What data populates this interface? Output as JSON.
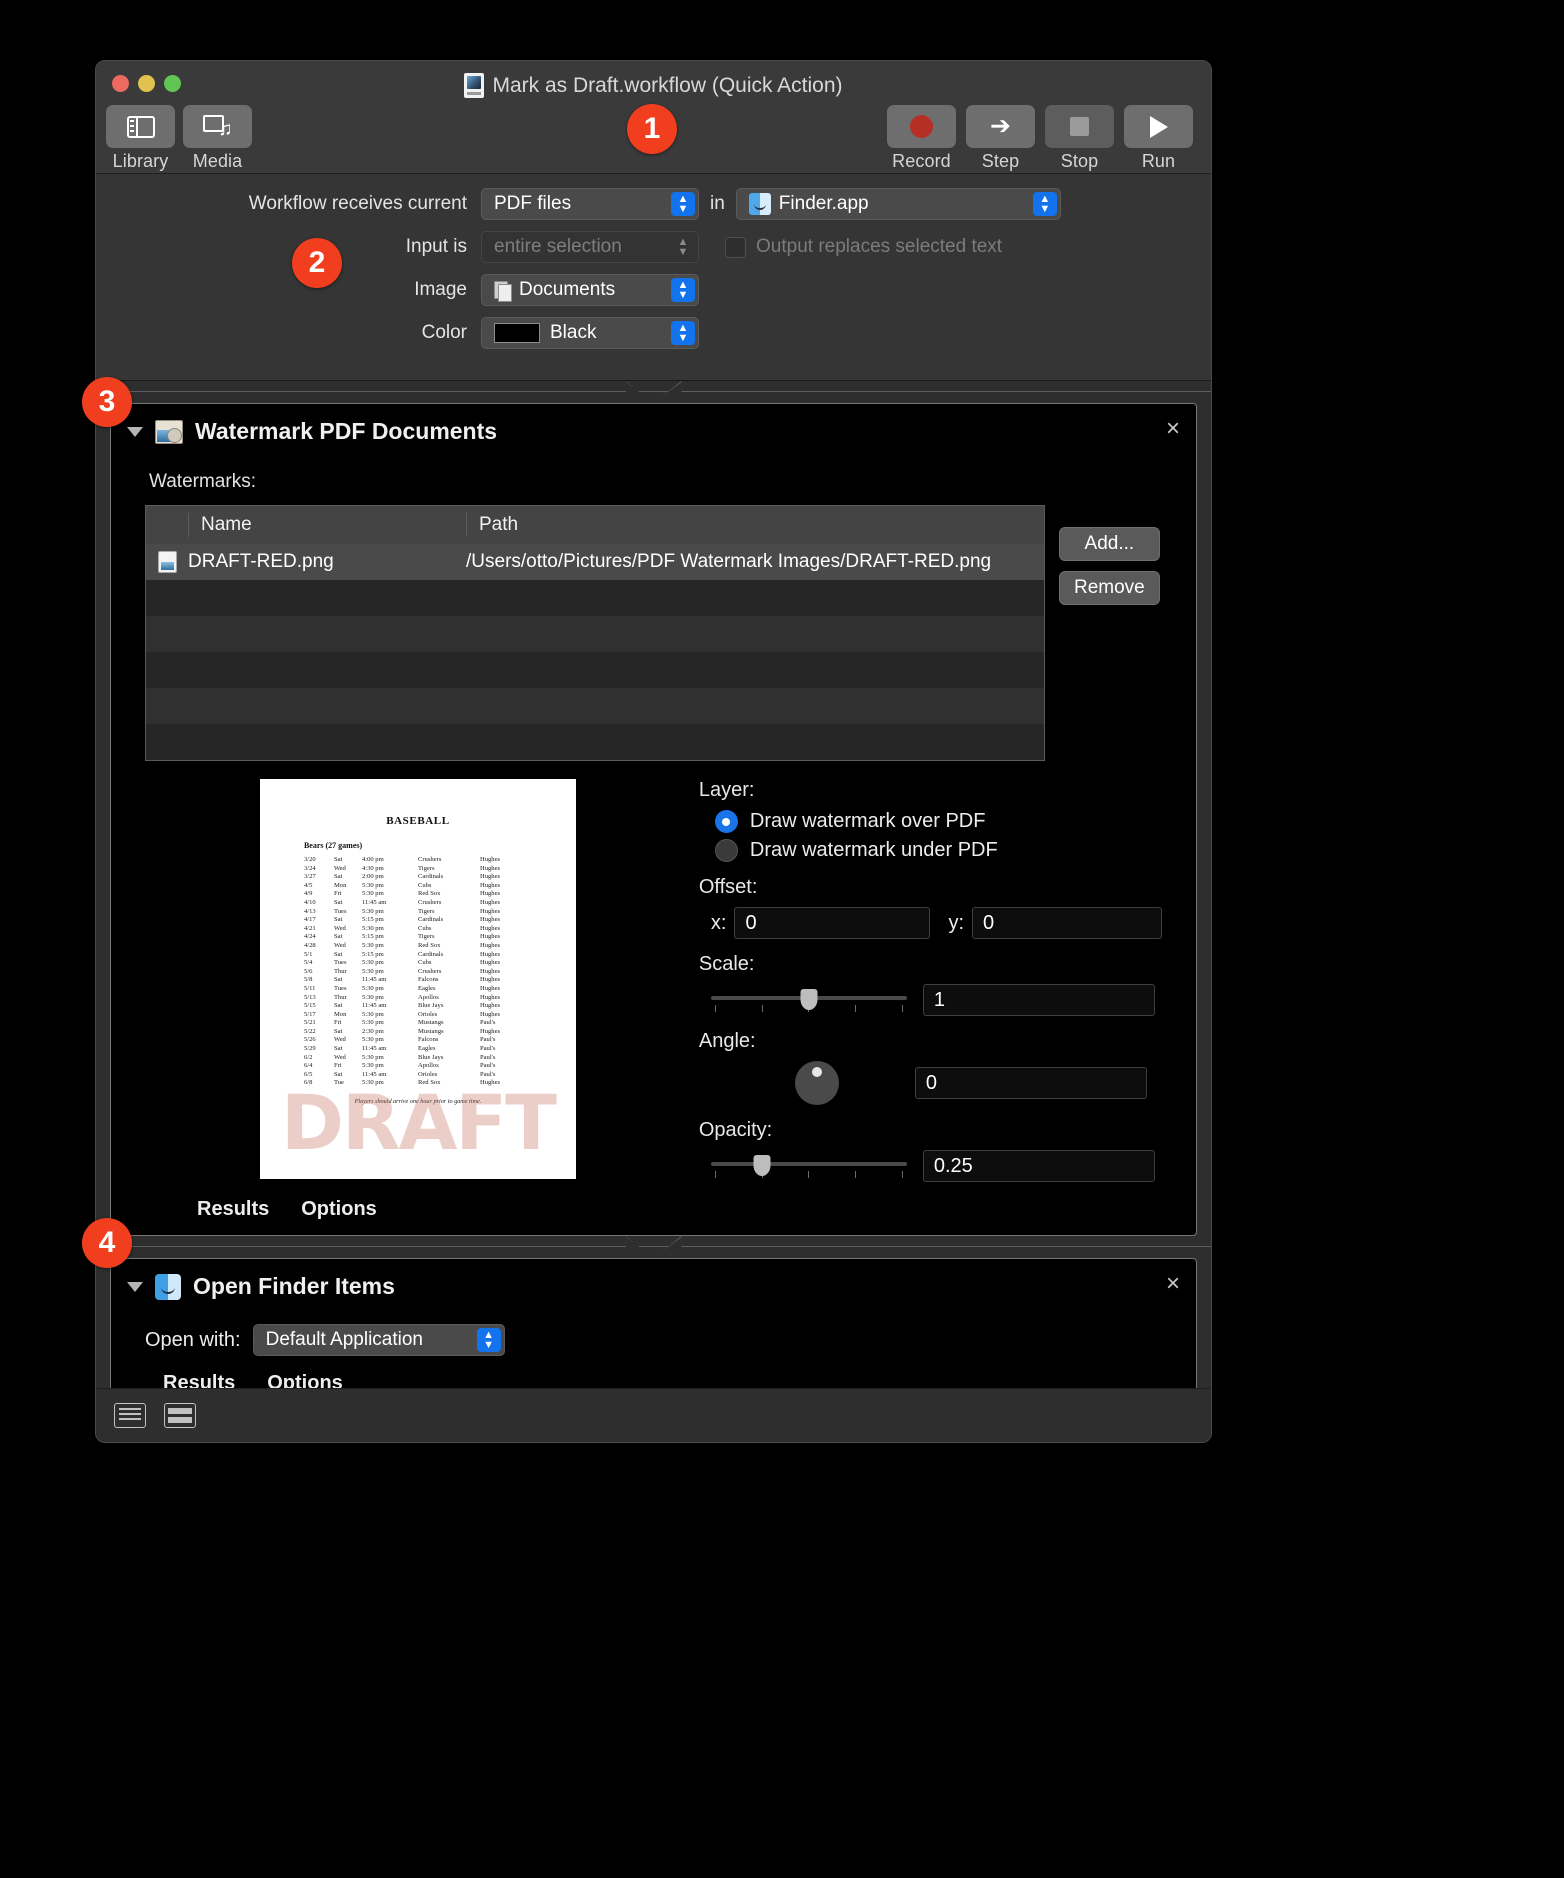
{
  "window": {
    "title": "Mark as Draft.workflow (Quick Action)",
    "doc_icon": "workflow-document-icon"
  },
  "toolbar": {
    "left": [
      {
        "label": "Library",
        "icon": "library-icon"
      },
      {
        "label": "Media",
        "icon": "media-icon"
      }
    ],
    "right": [
      {
        "label": "Record",
        "icon": "record-icon"
      },
      {
        "label": "Step",
        "icon": "step-forward-icon"
      },
      {
        "label": "Stop",
        "icon": "stop-icon"
      },
      {
        "label": "Run",
        "icon": "run-play-icon"
      }
    ]
  },
  "receives": {
    "row1_label": "Workflow receives current",
    "row1_value": "PDF files",
    "in_word": "in",
    "app_value": "Finder.app",
    "row2_label": "Input is",
    "row2_value": "entire selection",
    "checkbox_label": "Output replaces selected text",
    "row3_label": "Image",
    "row3_value": "Documents",
    "row4_label": "Color",
    "row4_value": "Black",
    "color_swatch": "#000000"
  },
  "watermark_action": {
    "title": "Watermark PDF Documents",
    "close": "×",
    "watermarks_label": "Watermarks:",
    "columns": [
      "Name",
      "Path"
    ],
    "rows": [
      {
        "name": "DRAFT-RED.png",
        "path": "/Users/otto/Pictures/PDF Watermark Images/DRAFT-RED.png"
      }
    ],
    "add_label": "Add...",
    "remove_label": "Remove",
    "layer_label": "Layer:",
    "layer_options": [
      {
        "label": "Draw watermark over PDF",
        "selected": true
      },
      {
        "label": "Draw watermark under PDF",
        "selected": false
      }
    ],
    "offset_label": "Offset:",
    "offset_x_label": "x:",
    "offset_x_value": "0",
    "offset_y_label": "y:",
    "offset_y_value": "0",
    "scale_label": "Scale:",
    "scale_value": "1",
    "angle_label": "Angle:",
    "angle_value": "0",
    "opacity_label": "Opacity:",
    "opacity_value": "0.25",
    "results_label": "Results",
    "options_label": "Options"
  },
  "preview": {
    "title": "BASEBALL",
    "team": "Bears (27 games)",
    "watermark_text": "DRAFT",
    "footer": "Players should arrive one hour prior to game time.",
    "schedule": [
      [
        "3/20",
        "Sat",
        "4:00 pm",
        "Crushers",
        "Hughes"
      ],
      [
        "3/24",
        "Wed",
        "4:30 pm",
        "Tigers",
        "Hughes"
      ],
      [
        "3/27",
        "Sat",
        "2:00 pm",
        "Cardinals",
        "Hughes"
      ],
      [
        "4/5",
        "Mon",
        "5:30 pm",
        "Cubs",
        "Hughes"
      ],
      [
        "4/9",
        "Fri",
        "5:30 pm",
        "Red Sox",
        "Hughes"
      ],
      [
        "4/10",
        "Sat",
        "11:45 am",
        "Crushers",
        "Hughes"
      ],
      [
        "4/13",
        "Tues",
        "5:30 pm",
        "Tigers",
        "Hughes"
      ],
      [
        "4/17",
        "Sat",
        "5:15 pm",
        "Cardinals",
        "Hughes"
      ],
      [
        "4/21",
        "Wed",
        "5:30 pm",
        "Cubs",
        "Hughes"
      ],
      [
        "4/24",
        "Sat",
        "5:15 pm",
        "Tigers",
        "Hughes"
      ],
      [
        "4/28",
        "Wed",
        "5:30 pm",
        "Red Sox",
        "Hughes"
      ],
      [
        "5/1",
        "Sat",
        "5:15 pm",
        "Cardinals",
        "Hughes"
      ],
      [
        "5/4",
        "Tues",
        "5:30 pm",
        "Cubs",
        "Hughes"
      ],
      [
        "5/6",
        "Thur",
        "5:30 pm",
        "Crushers",
        "Hughes"
      ],
      [
        "5/8",
        "Sat",
        "11:45 am",
        "Falcons",
        "Hughes"
      ],
      [
        "5/11",
        "Tues",
        "5:30 pm",
        "Eagles",
        "Hughes"
      ],
      [
        "5/13",
        "Thur",
        "5:30 pm",
        "Apollos",
        "Hughes"
      ],
      [
        "5/15",
        "Sat",
        "11:45 am",
        "Blue Jays",
        "Hughes"
      ],
      [
        "5/17",
        "Mon",
        "5:30 pm",
        "Orioles",
        "Hughes"
      ],
      [
        "5/21",
        "Fri",
        "5:30 pm",
        "Mustangs",
        "Paul's"
      ],
      [
        "5/22",
        "Sat",
        "2:30 pm",
        "Mustangs",
        "Hughes"
      ],
      [
        "5/26",
        "Wed",
        "5:30 pm",
        "Falcons",
        "Paul's"
      ],
      [
        "5/29",
        "Sat",
        "11:45 am",
        "Eagles",
        "Paul's"
      ],
      [
        "6/2",
        "Wed",
        "5:30 pm",
        "Blue Jays",
        "Paul's"
      ],
      [
        "6/4",
        "Fri",
        "5:30 pm",
        "Apollos",
        "Paul's"
      ],
      [
        "6/5",
        "Sat",
        "11:45 am",
        "Orioles",
        "Paul's"
      ],
      [
        "6/8",
        "Tue",
        "5:30 pm",
        "Red Sox",
        "Hughes"
      ]
    ]
  },
  "finder_action": {
    "title": "Open Finder Items",
    "close": "×",
    "open_with_label": "Open with:",
    "open_with_value": "Default Application",
    "results_label": "Results",
    "options_label": "Options"
  },
  "bottom_bar": {
    "buttons": [
      "log-view-icon",
      "split-view-icon"
    ]
  },
  "callouts": [
    {
      "number": "1"
    },
    {
      "number": "2"
    },
    {
      "number": "3"
    },
    {
      "number": "4"
    }
  ]
}
